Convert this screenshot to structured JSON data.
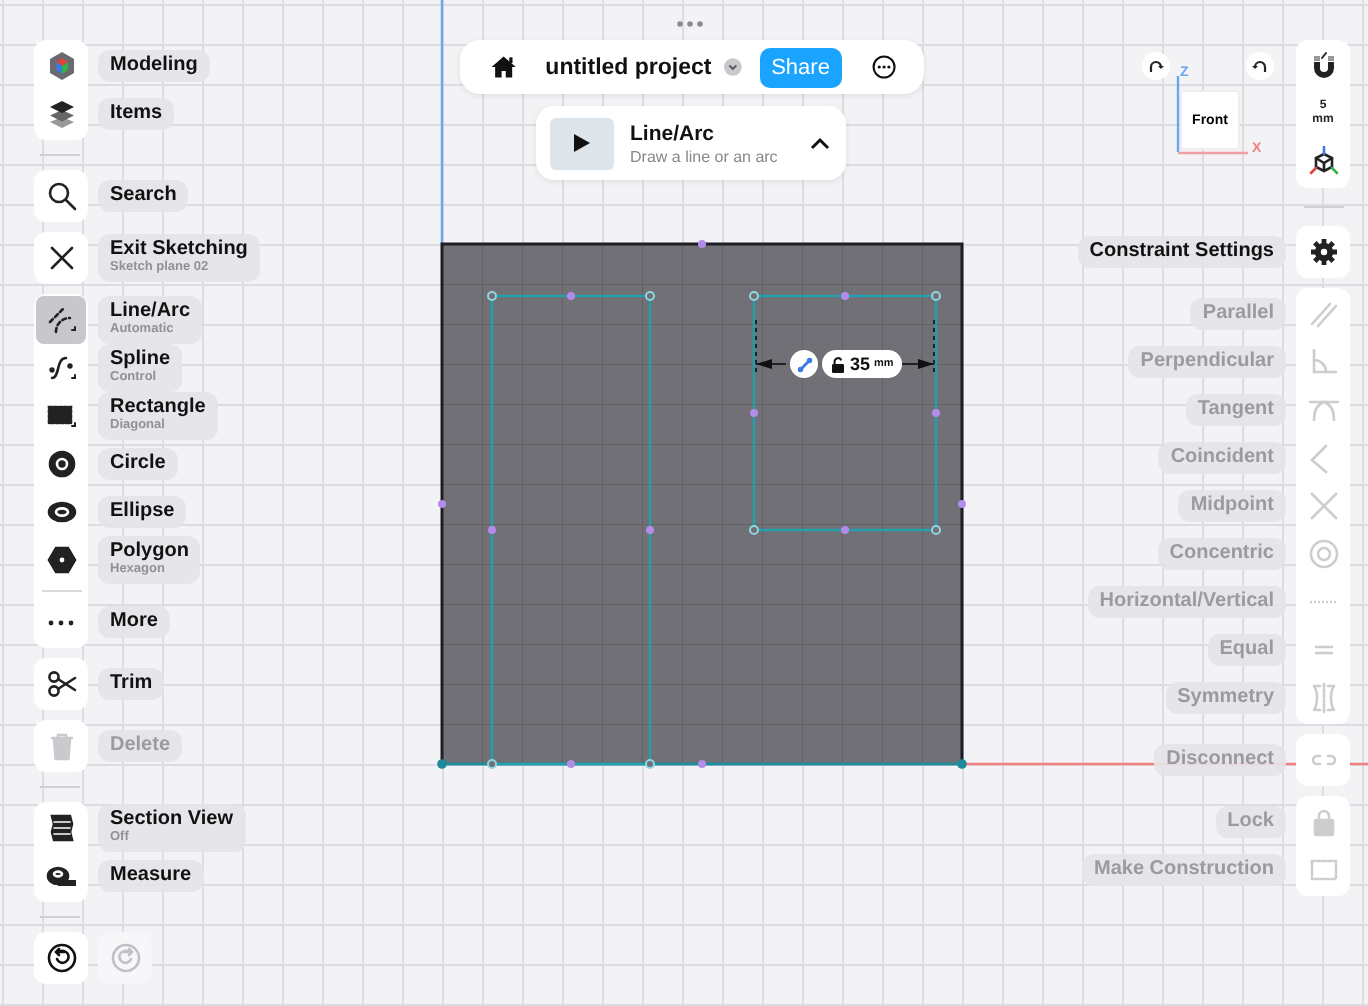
{
  "top_bar": {
    "title": "untitled project",
    "share": "Share"
  },
  "tool_card": {
    "title": "Line/Arc",
    "subtitle": "Draw a line or an arc"
  },
  "view_cube": {
    "face": "Front",
    "vertical_axis": "Z",
    "horizontal_axis": "X"
  },
  "sketch": {
    "dimension": {
      "value": "35",
      "unit": "mm"
    }
  },
  "left_toolbar": {
    "groups": [
      {
        "separated": false,
        "sections": [
          {
            "items": [
              {
                "kind": "modeling",
                "label": "Modeling",
                "selected": false,
                "disabled": false
              },
              {
                "kind": "layers",
                "label": "Items",
                "selected": false,
                "disabled": false
              }
            ]
          }
        ]
      },
      {
        "separated": true,
        "sections": [
          {
            "items": [
              {
                "kind": "search",
                "label": "Search",
                "selected": false,
                "disabled": false
              }
            ]
          }
        ]
      },
      {
        "separated": false,
        "sections": [
          {
            "items": [
              {
                "kind": "close",
                "label": "Exit Sketching",
                "sublabel": "Sketch plane 02",
                "selected": false,
                "disabled": false
              }
            ]
          }
        ]
      },
      {
        "separated": false,
        "sections": [
          {
            "items": [
              {
                "kind": "line",
                "label": "Line/Arc",
                "sublabel": "Automatic",
                "selected": true,
                "disabled": false
              },
              {
                "kind": "spline",
                "label": "Spline",
                "sublabel": "Control",
                "selected": false,
                "disabled": false
              },
              {
                "kind": "rectangle",
                "label": "Rectangle",
                "sublabel": "Diagonal",
                "selected": false,
                "disabled": false
              },
              {
                "kind": "circle",
                "label": "Circle",
                "selected": false,
                "disabled": false
              },
              {
                "kind": "ellipse",
                "label": "Ellipse",
                "selected": false,
                "disabled": false
              },
              {
                "kind": "polygon",
                "label": "Polygon",
                "sublabel": "Hexagon",
                "selected": false,
                "disabled": false
              }
            ]
          },
          {
            "items": [
              {
                "kind": "more",
                "label": "More",
                "selected": false,
                "disabled": false
              }
            ]
          }
        ]
      },
      {
        "separated": false,
        "sections": [
          {
            "items": [
              {
                "kind": "scissors",
                "label": "Trim",
                "selected": false,
                "disabled": false
              }
            ]
          }
        ]
      },
      {
        "separated": false,
        "sections": [
          {
            "items": [
              {
                "kind": "trash",
                "label": "Delete",
                "selected": false,
                "disabled": true
              }
            ]
          }
        ]
      },
      {
        "separated": true,
        "sections": [
          {
            "items": [
              {
                "kind": "section",
                "label": "Section View",
                "sublabel": "Off",
                "selected": false,
                "disabled": false
              },
              {
                "kind": "tape",
                "label": "Measure",
                "selected": false,
                "disabled": false
              }
            ]
          }
        ]
      }
    ],
    "history": [
      {
        "kind": "undo",
        "disabled": false
      },
      {
        "kind": "redo",
        "disabled": true
      }
    ]
  },
  "right_toolbar": {
    "groups": [
      {
        "separated": false,
        "items": [
          {
            "kind": "magnet",
            "disabled": false
          },
          {
            "kind": "scale",
            "value": "5",
            "unit": "mm",
            "disabled": false
          },
          {
            "kind": "axes",
            "disabled": false
          }
        ]
      },
      {
        "separated": true,
        "items": [
          {
            "kind": "gear",
            "label": "Constraint Settings",
            "disabled": false
          }
        ]
      },
      {
        "separated": false,
        "items": [
          {
            "kind": "parallel",
            "label": "Parallel",
            "disabled": true
          },
          {
            "kind": "perpendicular",
            "label": "Perpendicular",
            "disabled": true
          },
          {
            "kind": "tangent",
            "label": "Tangent",
            "disabled": true
          },
          {
            "kind": "coincident",
            "label": "Coincident",
            "disabled": true
          },
          {
            "kind": "midpoint",
            "label": "Midpoint",
            "disabled": true
          },
          {
            "kind": "concentric",
            "label": "Concentric",
            "disabled": true
          },
          {
            "kind": "horizontal",
            "label": "Horizontal/Vertical",
            "disabled": true
          },
          {
            "kind": "equal",
            "label": "Equal",
            "disabled": true
          },
          {
            "kind": "symmetry",
            "label": "Symmetry",
            "disabled": true
          }
        ]
      },
      {
        "separated": false,
        "items": [
          {
            "kind": "disconnect",
            "label": "Disconnect",
            "disabled": true
          }
        ]
      },
      {
        "separated": false,
        "items": [
          {
            "kind": "lock",
            "label": "Lock",
            "disabled": true
          },
          {
            "kind": "construction",
            "label": "Make Construction",
            "disabled": true
          }
        ]
      }
    ]
  }
}
